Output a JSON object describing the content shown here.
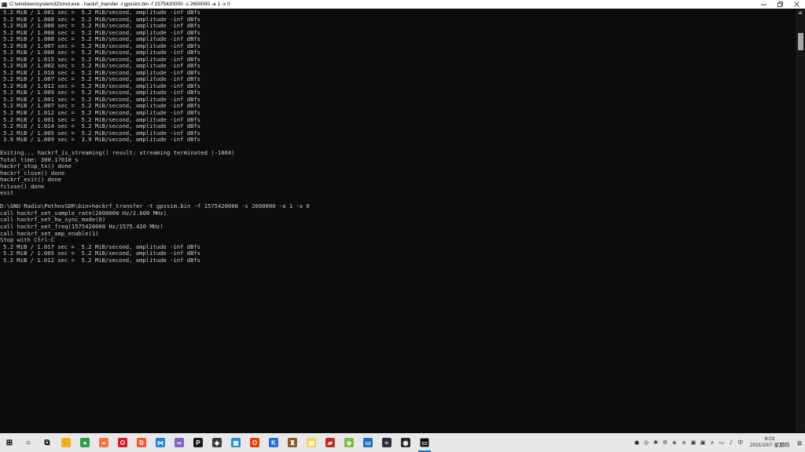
{
  "window": {
    "title": "C:\\windows\\system32\\cmd.exe - hackrf_transfer  -t gpssim.bin -f 1575420000 -s 2600000 -a 1 -x 0",
    "icon_label": "C:\\",
    "minimize_icon": "minimize-icon",
    "maximize_icon": "restore-icon",
    "close_icon": "close-icon"
  },
  "console": {
    "lines": [
      "5.2 MiB / 1.001 sec =  5.2 MiB/second, amplitude -inf dBfs",
      "5.2 MiB / 1.008 sec =  5.2 MiB/second, amplitude -inf dBfs",
      "5.2 MiB / 1.008 sec =  5.2 MiB/second, amplitude -inf dBfs",
      "5.2 MiB / 1.008 sec =  5.2 MiB/second, amplitude -inf dBfs",
      "5.2 MiB / 1.008 sec =  5.2 MiB/second, amplitude -inf dBfs",
      "5.2 MiB / 1.007 sec =  5.2 MiB/second, amplitude -inf dBfs",
      "5.2 MiB / 1.000 sec =  5.2 MiB/second, amplitude -inf dBfs",
      "5.2 MiB / 1.015 sec =  5.2 MiB/second, amplitude -inf dBfs",
      "5.2 MiB / 1.002 sec =  5.2 MiB/second, amplitude -inf dBfs",
      "5.2 MiB / 1.010 sec =  5.2 MiB/second, amplitude -inf dBfs",
      "5.2 MiB / 1.007 sec =  5.2 MiB/second, amplitude -inf dBfs",
      "5.2 MiB / 1.012 sec =  5.2 MiB/second, amplitude -inf dBfs",
      "5.2 MiB / 1.009 sec =  5.2 MiB/second, amplitude -inf dBfs",
      "5.2 MiB / 1.001 sec =  5.2 MiB/second, amplitude -inf dBfs",
      "5.2 MiB / 1.007 sec =  5.2 MiB/second, amplitude -inf dBfs",
      "5.2 MiB / 1.012 sec =  5.2 MiB/second, amplitude -inf dBfs",
      "5.2 MiB / 1.001 sec =  5.2 MiB/second, amplitude -inf dBfs",
      "5.2 MiB / 1.014 sec =  5.2 MiB/second, amplitude -inf dBfs",
      "5.2 MiB / 1.005 sec =  5.2 MiB/second, amplitude -inf dBfs",
      "3.9 MiB / 1.009 sec =  3.9 MiB/second, amplitude -inf dBfs",
      "",
      "Exiting... hackrf_is_streaming() result: streaming terminated (-1004)",
      "Total time: 300.17010 s",
      "hackrf_stop_tx() done",
      "hackrf_close() done",
      "hackrf_exit() done",
      "fclose() done",
      "exit",
      "",
      "D:\\GNU Radio\\PothosSDR\\bin>hackrf_transfer -t gpssim.bin -f 1575420000 -s 2600000 -a 1 -x 0",
      "call hackrf_set_sample_rate(2600000 Hz/2.600 MHz)",
      "call hackrf_set_hw_sync_mode(0)",
      "call hackrf_set_freq(1575420000 Hz/1575.420 MHz)",
      "call hackrf_set_amp_enable(1)",
      "Stop with Ctrl-C",
      "5.2 MiB / 1.017 sec =  5.2 MiB/second, amplitude -inf dBfs",
      "5.2 MiB / 1.005 sec =  5.2 MiB/second, amplitude -inf dBfs",
      "5.2 MiB / 1.012 sec =  5.2 MiB/second, amplitude -inf dBfs"
    ]
  },
  "taskbar": {
    "apps": [
      {
        "name": "start-button",
        "icon": "windows-logo-icon",
        "color": "#000000",
        "char": "⊞"
      },
      {
        "name": "search-button",
        "icon": "search-circle-icon",
        "color": "#000000",
        "char": "○"
      },
      {
        "name": "task-view-button",
        "icon": "task-view-icon",
        "color": "#000000",
        "char": "⧉"
      },
      {
        "name": "taskbar-file-explorer",
        "icon": "folder-icon",
        "color": "#f2b01e",
        "char": ""
      },
      {
        "name": "taskbar-chrome",
        "icon": "chrome-icon",
        "color": "#2f9e44",
        "char": "●"
      },
      {
        "name": "taskbar-firefox",
        "icon": "firefox-icon",
        "color": "#ff7139",
        "char": "●"
      },
      {
        "name": "taskbar-opera",
        "icon": "opera-icon",
        "color": "#e0152a",
        "char": "O"
      },
      {
        "name": "taskbar-brave",
        "icon": "brave-icon",
        "color": "#fb542b",
        "char": "B"
      },
      {
        "name": "taskbar-vscode",
        "icon": "vscode-icon",
        "color": "#1f84d6",
        "char": "⋈"
      },
      {
        "name": "taskbar-visual-studio",
        "icon": "visual-studio-icon",
        "color": "#8661c5",
        "char": "∞"
      },
      {
        "name": "taskbar-pycharm",
        "icon": "pycharm-icon",
        "color": "#1b1b1b",
        "char": "P"
      },
      {
        "name": "taskbar-app-dark",
        "icon": "app-icon",
        "color": "#3a3a3a",
        "char": "◈"
      },
      {
        "name": "taskbar-settings-blue",
        "icon": "window-icon",
        "color": "#1b8fd1",
        "char": "▣"
      },
      {
        "name": "taskbar-office",
        "icon": "office-icon",
        "color": "#eb3c00",
        "char": "O"
      },
      {
        "name": "taskbar-app-k",
        "icon": "k-icon",
        "color": "#1f6fe0",
        "char": "K"
      },
      {
        "name": "taskbar-app-bottle",
        "icon": "bottle-icon",
        "color": "#8b5a2b",
        "char": "♜"
      },
      {
        "name": "taskbar-app-yellow",
        "icon": "note-icon",
        "color": "#f5d34a",
        "char": "▤"
      },
      {
        "name": "taskbar-app-red",
        "icon": "box-icon",
        "color": "#c8281e",
        "char": "▰"
      },
      {
        "name": "taskbar-app-green",
        "icon": "leaf-icon",
        "color": "#7cbf3a",
        "char": "◆"
      },
      {
        "name": "taskbar-app-monitor",
        "icon": "monitor-icon",
        "color": "#1e6fb8",
        "char": "▭"
      },
      {
        "name": "taskbar-app-chart",
        "icon": "chart-icon",
        "color": "#2c2c3a",
        "char": "≈"
      },
      {
        "name": "taskbar-github",
        "icon": "github-icon",
        "color": "#24292e",
        "char": "◉"
      },
      {
        "name": "taskbar-cmd",
        "icon": "terminal-icon",
        "color": "#0c0c0c",
        "char": "▭"
      }
    ],
    "tray": {
      "icons": [
        "●",
        "◎",
        "✱",
        "⚙",
        "◈",
        "ʙ",
        "▣",
        "▣",
        "∧",
        "▭",
        "♪",
        "中"
      ],
      "time": "9:03",
      "date": "2021/10/7 星期四"
    },
    "accent": "#0078d7"
  }
}
